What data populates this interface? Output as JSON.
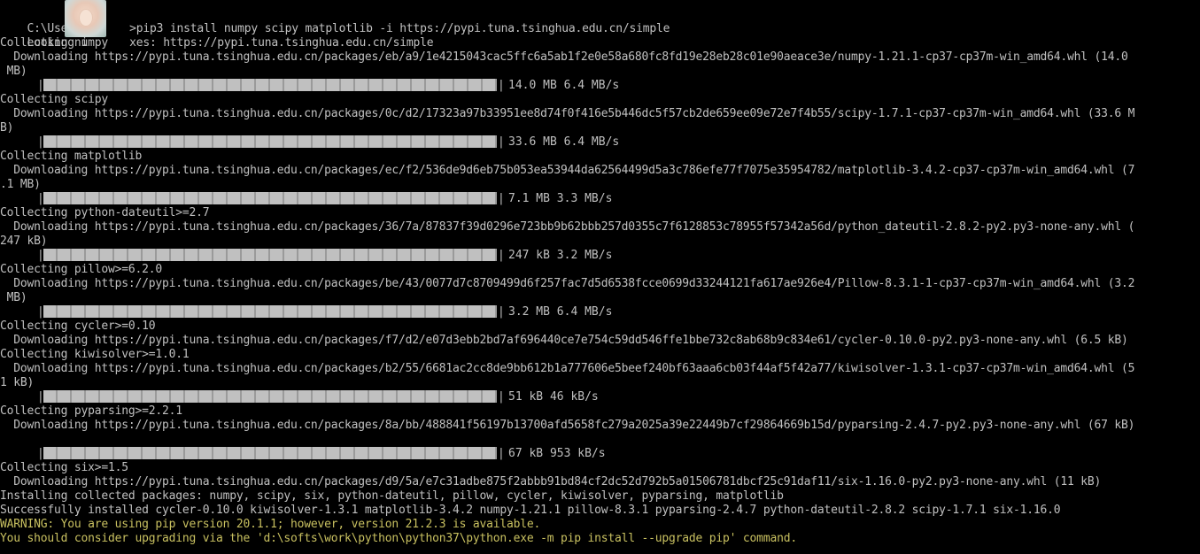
{
  "terminal": {
    "line_prompt_left": "C:\\Users\\",
    "line_prompt_right": ">pip3 install numpy scipy matplotlib -i https://pypi.tuna.tsinghua.edu.cn/simple",
    "line_looking_left": "Looking i",
    "line_looking_right": "xes: https://pypi.tuna.tsinghua.edu.cn/simple",
    "numpy_collect": "Collecting numpy",
    "numpy_dl_1": "  Downloading https://pypi.tuna.tsinghua.edu.cn/packages/eb/a9/1e4215043cac5ffc6a5ab1f2e0e58a680fc8fd19e28eb28c01e90aeace3e/numpy-1.21.1-cp37-cp37m-win_amd64.whl (14.0",
    "numpy_dl_2": " MB)",
    "numpy_bar": "14.0 MB 6.4 MB/s",
    "scipy_collect": "Collecting scipy",
    "scipy_dl_1": "  Downloading https://pypi.tuna.tsinghua.edu.cn/packages/0c/d2/17323a97b33951ee8d74f0f416e5b446dc5f57cb2de659ee09e72e7f4b55/scipy-1.7.1-cp37-cp37m-win_amd64.whl (33.6 M",
    "scipy_dl_2": "B)",
    "scipy_bar": "33.6 MB 6.4 MB/s",
    "mpl_collect": "Collecting matplotlib",
    "mpl_dl_1": "  Downloading https://pypi.tuna.tsinghua.edu.cn/packages/ec/f2/536de9d6eb75b053ea53944da62564499d5a3c786efe77f7075e35954782/matplotlib-3.4.2-cp37-cp37m-win_amd64.whl (7",
    "mpl_dl_2": ".1 MB)",
    "mpl_bar": "7.1 MB 3.3 MB/s",
    "dateutil_collect": "Collecting python-dateutil>=2.7",
    "dateutil_dl_1": "  Downloading https://pypi.tuna.tsinghua.edu.cn/packages/36/7a/87837f39d0296e723bb9b62bbb257d0355c7f6128853c78955f57342a56d/python_dateutil-2.8.2-py2.py3-none-any.whl (",
    "dateutil_dl_2": "247 kB)",
    "dateutil_bar": "247 kB 3.2 MB/s",
    "pillow_collect": "Collecting pillow>=6.2.0",
    "pillow_dl_1": "  Downloading https://pypi.tuna.tsinghua.edu.cn/packages/be/43/0077d7c8709499d6f257fac7d5d6538fcce0699d33244121fa617ae926e4/Pillow-8.3.1-1-cp37-cp37m-win_amd64.whl (3.2",
    "pillow_dl_2": " MB)",
    "pillow_bar": "3.2 MB 6.4 MB/s",
    "cycler_collect": "Collecting cycler>=0.10",
    "cycler_dl": "  Downloading https://pypi.tuna.tsinghua.edu.cn/packages/f7/d2/e07d3ebb2bd7af696440ce7e754c59dd546ffe1bbe732c8ab68b9c834e61/cycler-0.10.0-py2.py3-none-any.whl (6.5 kB)",
    "kiwi_collect": "Collecting kiwisolver>=1.0.1",
    "kiwi_dl_1": "  Downloading https://pypi.tuna.tsinghua.edu.cn/packages/b2/55/6681ac2cc8de9bb612b1a777606e5beef240bf63aaa6cb03f44af5f42a77/kiwisolver-1.3.1-cp37-cp37m-win_amd64.whl (5",
    "kiwi_dl_2": "1 kB)",
    "kiwi_bar": "51 kB 46 kB/s",
    "pyparsing_collect": "Collecting pyparsing>=2.2.1",
    "pyparsing_dl": "  Downloading https://pypi.tuna.tsinghua.edu.cn/packages/8a/bb/488841f56197b13700afd5658fc279a2025a39e22449b7cf29864669b15d/pyparsing-2.4.7-py2.py3-none-any.whl (67 kB)",
    "pyparsing_bar": "67 kB 953 kB/s",
    "six_collect": "Collecting six>=1.5",
    "six_dl": "  Downloading https://pypi.tuna.tsinghua.edu.cn/packages/d9/5a/e7c31adbe875f2abbb91bd84cf2dc52d792b5a01506781dbcf25c91daf11/six-1.16.0-py2.py3-none-any.whl (11 kB)",
    "installing": "Installing collected packages: numpy, scipy, six, python-dateutil, pillow, cycler, kiwisolver, pyparsing, matplotlib",
    "success": "Successfully installed cycler-0.10.0 kiwisolver-1.3.1 matplotlib-3.4.2 numpy-1.21.1 pillow-8.3.1 pyparsing-2.4.7 python-dateutil-2.8.2 scipy-1.7.1 six-1.16.0",
    "warning_1": "WARNING: You are using pip version 20.1.1; however, version 21.2.3 is available.",
    "warning_2": "You should consider upgrading via the 'd:\\softs\\work\\python\\python37\\python.exe -m pip install --upgrade pip' command."
  },
  "colors": {
    "background": "#000000",
    "text": "#c0c0c0",
    "warning": "#c8c060"
  },
  "icons": {
    "avatar": "user-avatar-icon"
  }
}
